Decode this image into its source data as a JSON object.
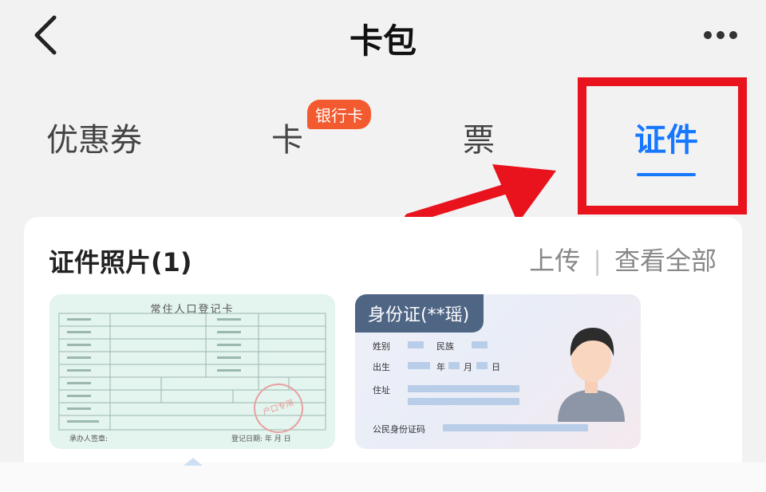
{
  "header": {
    "title": "卡包",
    "back_icon": "chevron-left-icon",
    "more_icon": "more-dots-icon"
  },
  "tabs": [
    {
      "label": "优惠券"
    },
    {
      "label": "卡",
      "badge": "银行卡"
    },
    {
      "label": "票"
    },
    {
      "label": "证件",
      "active": true
    }
  ],
  "annotation": {
    "box_color": "#e8131d",
    "arrow_color": "#e8131d"
  },
  "photos_section": {
    "title": "证件照片(1)",
    "upload_label": "上传",
    "separator": "|",
    "view_all_label": "查看全部"
  },
  "household_card": {
    "title": "常住人口登记卡",
    "footer_left": "承办人签章:",
    "footer_right": "登记日期:    年   月   日",
    "stamp_text": "户口专用"
  },
  "id_card": {
    "tag": "身份证(**瑶)",
    "labels": {
      "gender": "姓别",
      "ethnicity": "民族",
      "birth": "出生",
      "year": "年",
      "month": "月",
      "day": "日",
      "address": "住址",
      "id_number": "公民身份证码"
    }
  },
  "colors": {
    "accent": "#1677ff",
    "badge": "#f35a2f",
    "id_tag": "#4e6584"
  }
}
